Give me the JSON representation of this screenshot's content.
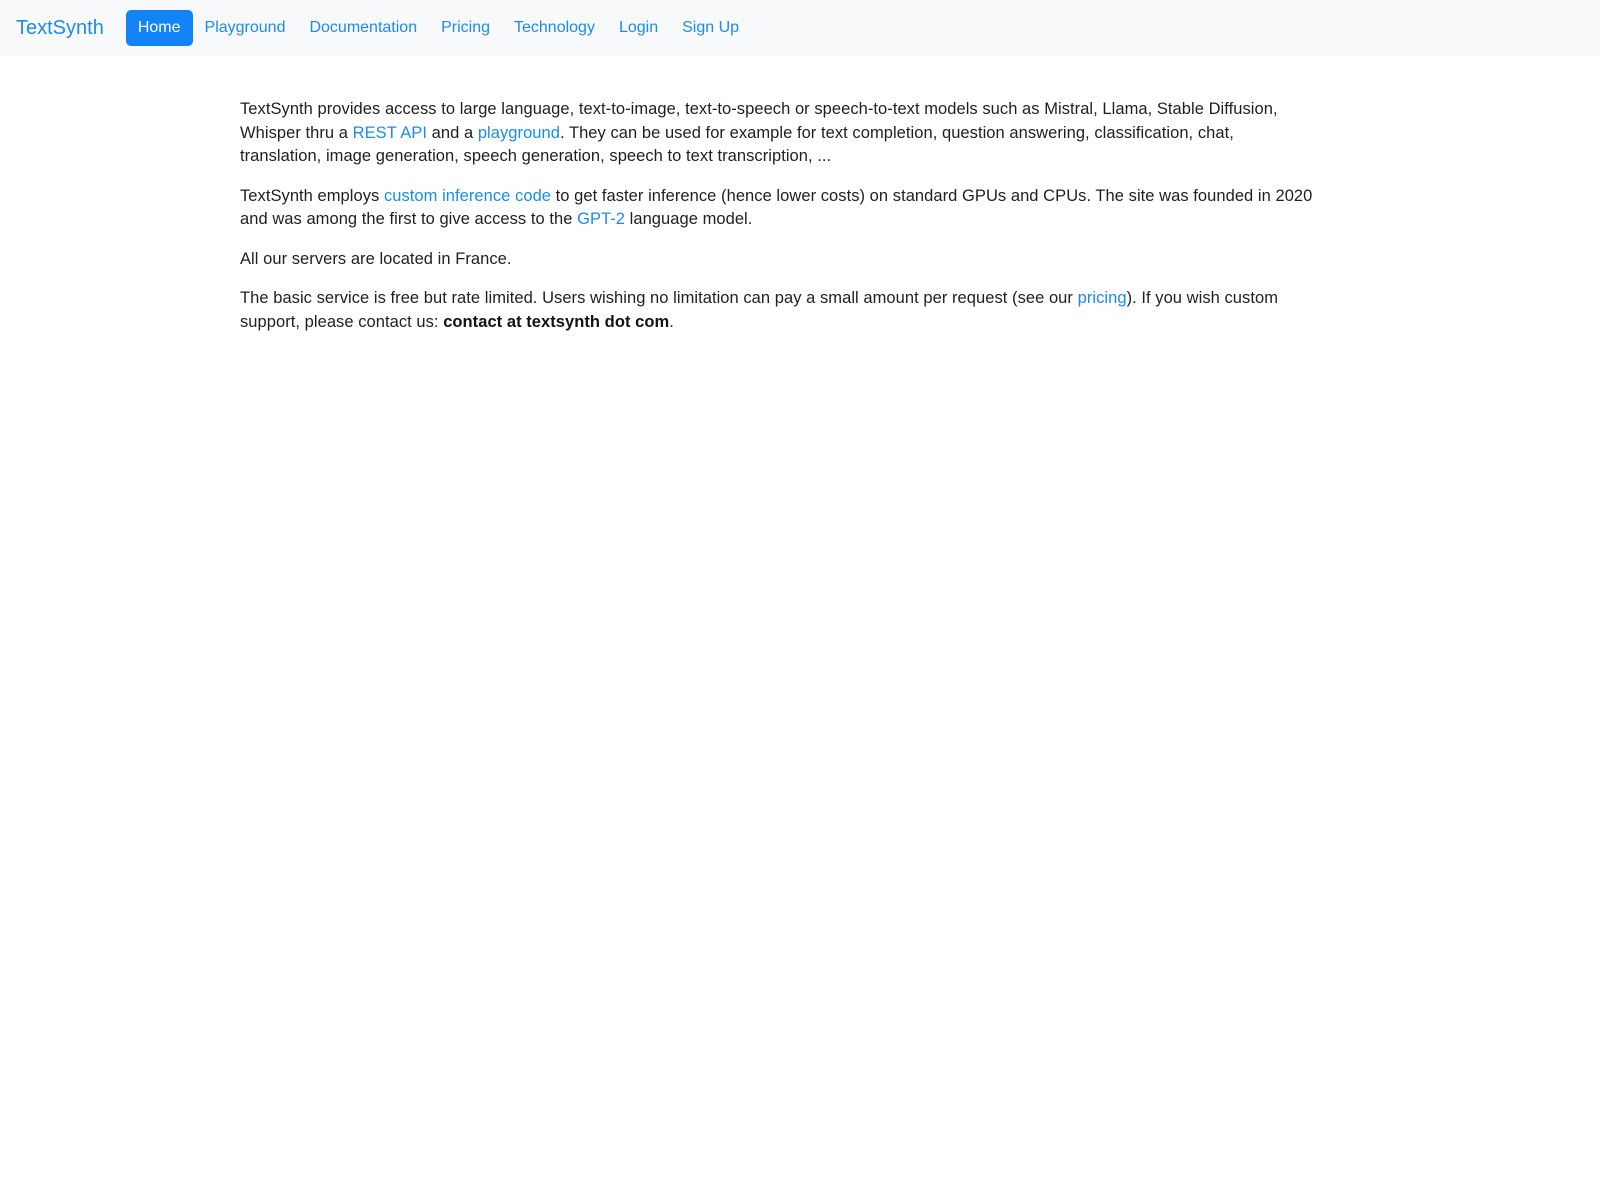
{
  "navbar": {
    "brand": "TextSynth",
    "items": [
      {
        "label": "Home",
        "active": true
      },
      {
        "label": "Playground",
        "active": false
      },
      {
        "label": "Documentation",
        "active": false
      },
      {
        "label": "Pricing",
        "active": false
      },
      {
        "label": "Technology",
        "active": false
      },
      {
        "label": "Login",
        "active": false
      },
      {
        "label": "Sign Up",
        "active": false
      }
    ],
    "active_bg_color": "#1284f7",
    "active_text_color": "#ffffff",
    "link_color": "#1a8cf0",
    "background_color": "#f8f9fa"
  },
  "main": {
    "paragraph1": {
      "part1": "TextSynth provides access to large language, text-to-image, text-to-speech or speech-to-text models such as Mistral, Llama, Stable Diffusion, Whisper thru a ",
      "link1": "REST API",
      "part2": " and a ",
      "link2": "playground",
      "part3": ". They can be used for example for text completion, question answering, classification, chat, translation, image generation, speech generation, speech to text transcription, ..."
    },
    "paragraph2": {
      "part1": "TextSynth employs ",
      "link1": "custom inference code",
      "part2": " to get faster inference (hence lower costs) on standard GPUs and CPUs. The site was founded in 2020 and was among the first to give access to the ",
      "link2": "GPT-2",
      "part3": " language model."
    },
    "paragraph3": {
      "text": "All our servers are located in France."
    },
    "paragraph4": {
      "part1": "The basic service is free but rate limited. Users wishing no limitation can pay a small amount per request (see our ",
      "link1": "pricing",
      "part2": "). If you wish custom support, please contact us: ",
      "contact": "contact at textsynth dot com",
      "part3": "."
    }
  }
}
